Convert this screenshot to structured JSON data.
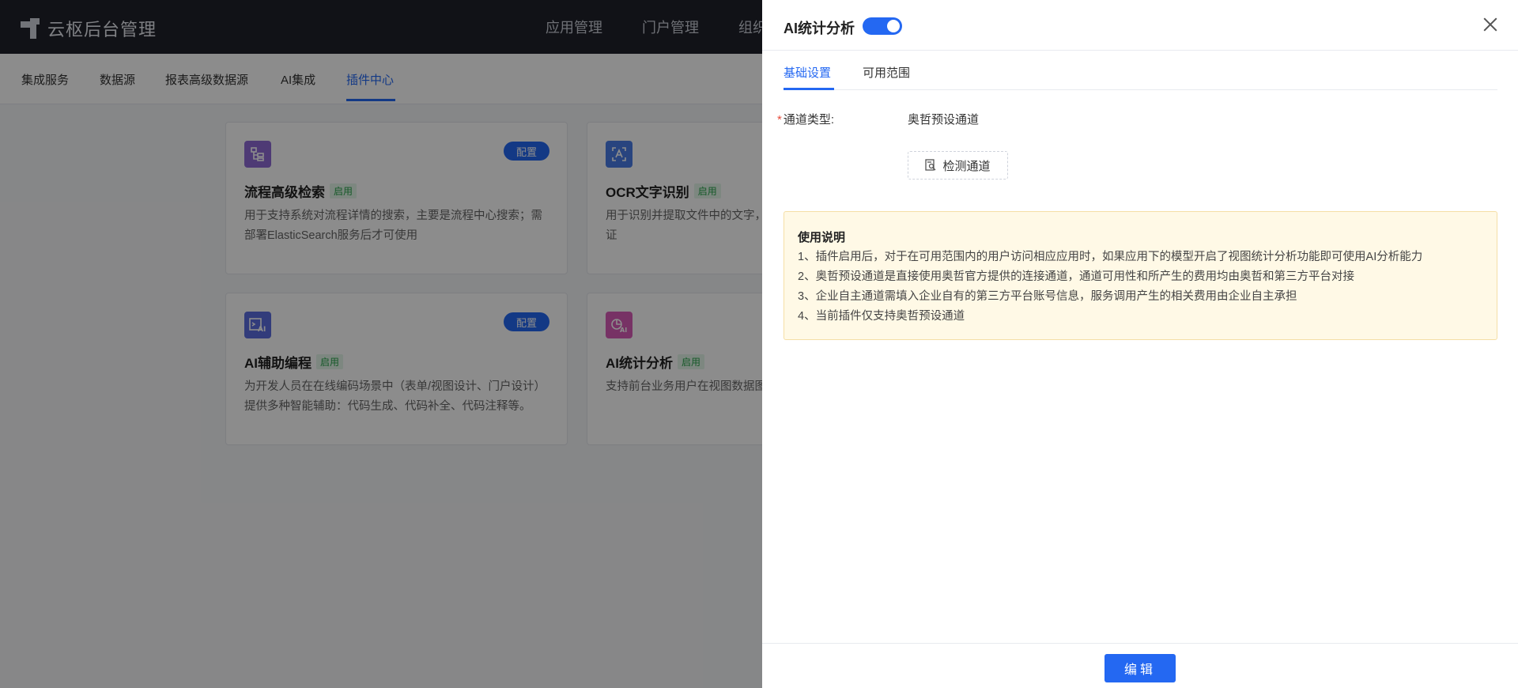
{
  "app": {
    "title": "云枢后台管理"
  },
  "topnav": [
    "应用管理",
    "门户管理",
    "组织"
  ],
  "subnav": {
    "items": [
      "集成服务",
      "数据源",
      "报表高级数据源",
      "AI集成",
      "插件中心"
    ],
    "active": "插件中心"
  },
  "cards": [
    {
      "title": "流程高级检索",
      "tag": "启用",
      "button": "配置",
      "icon": "flow-tree-icon",
      "desc": "用于支持系统对流程详情的搜索，主要是流程中心搜索；需部署ElasticSearch服务后才可使用"
    },
    {
      "title": "OCR文字识别",
      "tag": "启用",
      "icon": "ocr-scan-icon",
      "desc": "用于识别并提取文件中的文字，指定字段中。例如:读取身份证"
    },
    {
      "title": "AI辅助编程",
      "tag": "启用",
      "button": "配置",
      "icon": "ai-code-icon",
      "desc": "为开发人员在在线编码场景中（表单/视图设计、门户设计）提供多种智能辅助：代码生成、代码补全、代码注释等。"
    },
    {
      "title": "AI统计分析",
      "tag": "启用",
      "icon": "ai-chart-icon",
      "desc": "支持前台业务用户在视图数据图表，完成数据洞察。"
    }
  ],
  "drawer": {
    "title": "AI统计分析",
    "enabled": true,
    "tabs": [
      "基础设置",
      "可用范围"
    ],
    "active_tab": "基础设置",
    "form": {
      "label": "通道类型:",
      "value": "奥哲预设通道",
      "check_button": "检测通道"
    },
    "notice": {
      "title": "使用说明",
      "lines": [
        "1、插件启用后，对于在可用范围内的用户访问相应应用时，如果应用下的模型开启了视图统计分析功能即可使用AI分析能力",
        "2、奥哲预设通道是直接使用奥哲官方提供的连接通道，通道可用性和所产生的费用均由奥哲和第三方平台对接",
        "3、企业自主通道需填入企业自有的第三方平台账号信息，服务调用产生的相关费用由企业自主承担",
        "4、当前插件仅支持奥哲预设通道"
      ]
    },
    "footer": {
      "edit_button": "编辑"
    }
  },
  "colors": {
    "primary": "#2468f2",
    "topbar": "#1f222b",
    "notice_bg": "#fff9e6"
  }
}
